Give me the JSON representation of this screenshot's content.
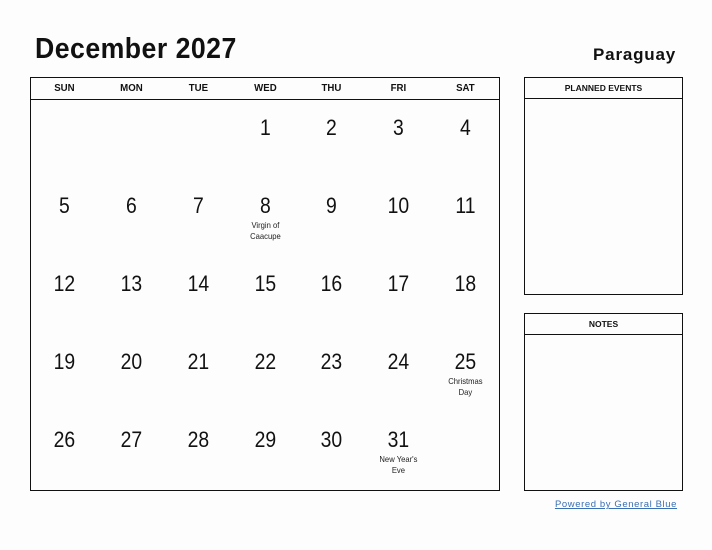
{
  "header": {
    "title": "December 2027",
    "country": "Paraguay"
  },
  "calendar": {
    "weekdays": [
      "SUN",
      "MON",
      "TUE",
      "WED",
      "THU",
      "FRI",
      "SAT"
    ],
    "weeks": [
      [
        {
          "day": ""
        },
        {
          "day": ""
        },
        {
          "day": ""
        },
        {
          "day": "1"
        },
        {
          "day": "2"
        },
        {
          "day": "3"
        },
        {
          "day": "4"
        }
      ],
      [
        {
          "day": "5"
        },
        {
          "day": "6"
        },
        {
          "day": "7"
        },
        {
          "day": "8",
          "event": "Virgin of Caacupe"
        },
        {
          "day": "9"
        },
        {
          "day": "10"
        },
        {
          "day": "11"
        }
      ],
      [
        {
          "day": "12"
        },
        {
          "day": "13"
        },
        {
          "day": "14"
        },
        {
          "day": "15"
        },
        {
          "day": "16"
        },
        {
          "day": "17"
        },
        {
          "day": "18"
        }
      ],
      [
        {
          "day": "19"
        },
        {
          "day": "20"
        },
        {
          "day": "21"
        },
        {
          "day": "22"
        },
        {
          "day": "23"
        },
        {
          "day": "24"
        },
        {
          "day": "25",
          "event": "Christmas Day"
        }
      ],
      [
        {
          "day": "26"
        },
        {
          "day": "27"
        },
        {
          "day": "28"
        },
        {
          "day": "29"
        },
        {
          "day": "30"
        },
        {
          "day": "31",
          "event": "New Year's Eve"
        },
        {
          "day": ""
        }
      ]
    ]
  },
  "sidebar": {
    "planned_events_label": "PLANNED EVENTS",
    "notes_label": "NOTES"
  },
  "footer": {
    "powered_by": "Powered by General Blue",
    "link_color": "#3a6fb5"
  }
}
